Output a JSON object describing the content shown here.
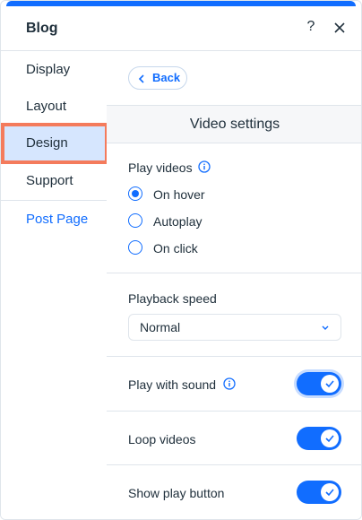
{
  "header": {
    "title": "Blog",
    "help_glyph": "?"
  },
  "sidebar": {
    "items": [
      {
        "label": "Display"
      },
      {
        "label": "Layout"
      },
      {
        "label": "Design"
      },
      {
        "label": "Support"
      }
    ],
    "link": "Post Page",
    "active": "Design"
  },
  "main": {
    "back_label": "Back",
    "section_title": "Video settings",
    "play_videos": {
      "label": "Play videos",
      "options": [
        "On hover",
        "Autoplay",
        "On click"
      ],
      "selected": "On hover"
    },
    "playback_speed": {
      "label": "Playback speed",
      "value": "Normal"
    },
    "toggles": [
      {
        "label": "Play with sound",
        "on": true
      },
      {
        "label": "Loop videos",
        "on": true
      },
      {
        "label": "Show play button",
        "on": true
      }
    ]
  },
  "colors": {
    "accent": "#116dff",
    "highlight": "#f47b5c",
    "selected_bg": "#d6e6fe"
  }
}
